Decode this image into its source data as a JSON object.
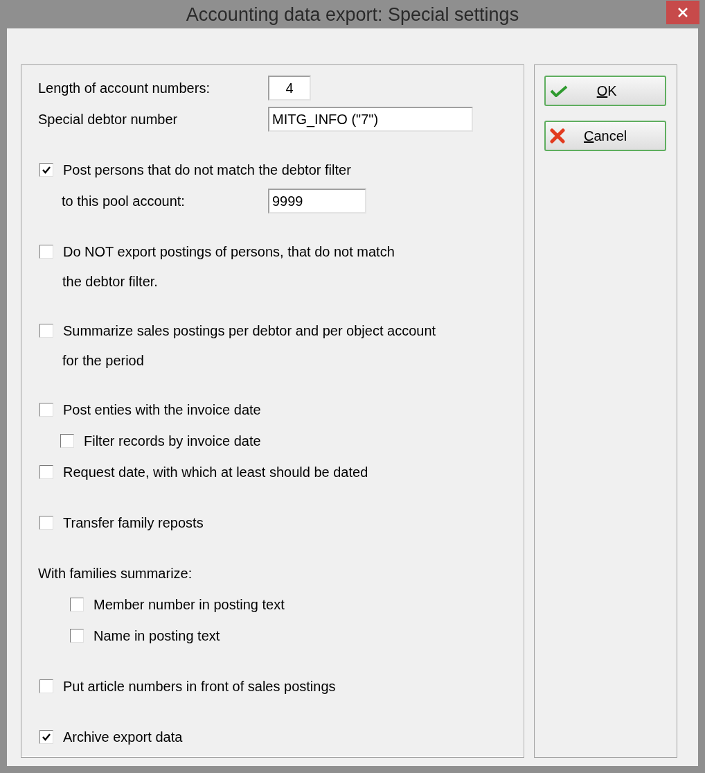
{
  "window": {
    "title": "Accounting data export: Special settings"
  },
  "groups": [
    [
      {
        "kind": "field",
        "label": "Length of account numbers:",
        "value": "4"
      },
      {
        "kind": "field",
        "label": "Special debtor number",
        "value": "MITG_INFO (\"7\")"
      }
    ],
    [
      {
        "kind": "checkbox",
        "lines": [
          "Post persons that do not match the debtor filter"
        ],
        "checked": true
      },
      {
        "kind": "subfield",
        "label": "to this pool account:",
        "value": "9999"
      }
    ],
    [
      {
        "kind": "checkbox",
        "lines": [
          "Do NOT export postings of persons, that do not match",
          "the debtor filter."
        ],
        "checked": false
      }
    ],
    [
      {
        "kind": "checkbox",
        "lines": [
          "Summarize sales postings per debtor and per object account",
          "for the period"
        ],
        "checked": false
      }
    ],
    [
      {
        "kind": "checkbox",
        "lines": [
          "Post enties with the invoice date"
        ],
        "checked": false,
        "children": [
          {
            "label": "Filter records by invoice date",
            "checked": false
          }
        ]
      },
      {
        "kind": "checkbox",
        "lines": [
          "Request date, with which at least should be dated"
        ],
        "checked": false
      }
    ],
    [
      {
        "kind": "checkbox",
        "lines": [
          "Transfer family reposts"
        ],
        "checked": false
      }
    ],
    [
      {
        "kind": "heading",
        "label": "With families summarize:",
        "children": [
          {
            "label": "Member number in posting text",
            "checked": false
          },
          {
            "label": "Name in posting text",
            "checked": false
          }
        ]
      }
    ],
    [
      {
        "kind": "checkbox",
        "lines": [
          "Put article numbers in front of sales postings"
        ],
        "checked": false
      }
    ],
    [
      {
        "kind": "checkbox",
        "lines": [
          "Archive export data"
        ],
        "checked": true
      }
    ]
  ],
  "buttons": [
    {
      "kind": "ok",
      "label": "OK"
    },
    {
      "kind": "cancel",
      "label": "Cancel"
    }
  ]
}
